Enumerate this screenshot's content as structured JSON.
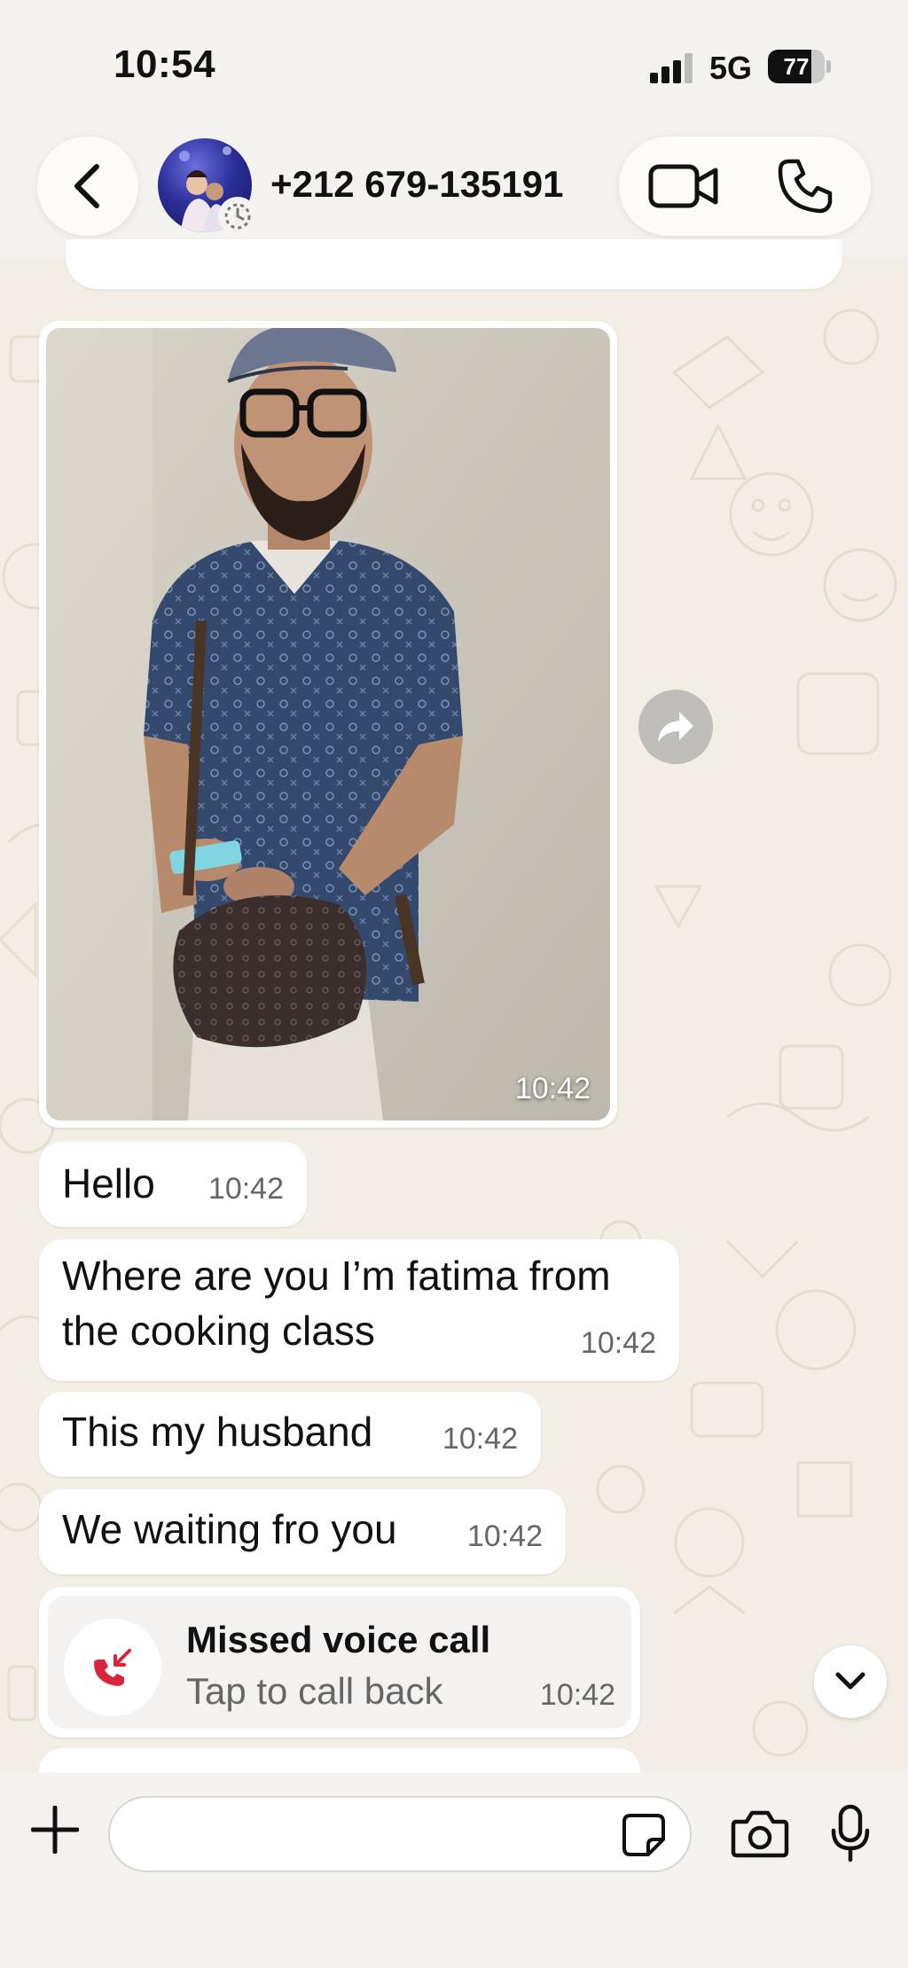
{
  "status_bar": {
    "time": "10:54",
    "network": "5G",
    "battery": "77",
    "battery_level": 0.77
  },
  "header": {
    "contact_name": "+212 679-135191",
    "back_icon": "chevron-left-icon",
    "video_icon": "video-camera-icon",
    "call_icon": "phone-icon"
  },
  "messages": {
    "image": {
      "time": "10:42"
    },
    "texts": [
      {
        "text": "Hello",
        "time": "10:42"
      },
      {
        "text": "Where are you I’m fatima from the cooking class",
        "time": "10:42"
      },
      {
        "text": "This my husband",
        "time": "10:42"
      },
      {
        "text": "We waiting fro you",
        "time": "10:42"
      }
    ],
    "missed_call": {
      "title": "Missed voice call",
      "subtitle": "Tap to call back",
      "time": "10:42"
    }
  },
  "composer": {
    "placeholder": "",
    "value": ""
  },
  "colors": {
    "wallpaper": "#f2eee6",
    "bubble": "#ffffff",
    "missed_call_red": "#d8243c",
    "time_gray": "#666666"
  }
}
